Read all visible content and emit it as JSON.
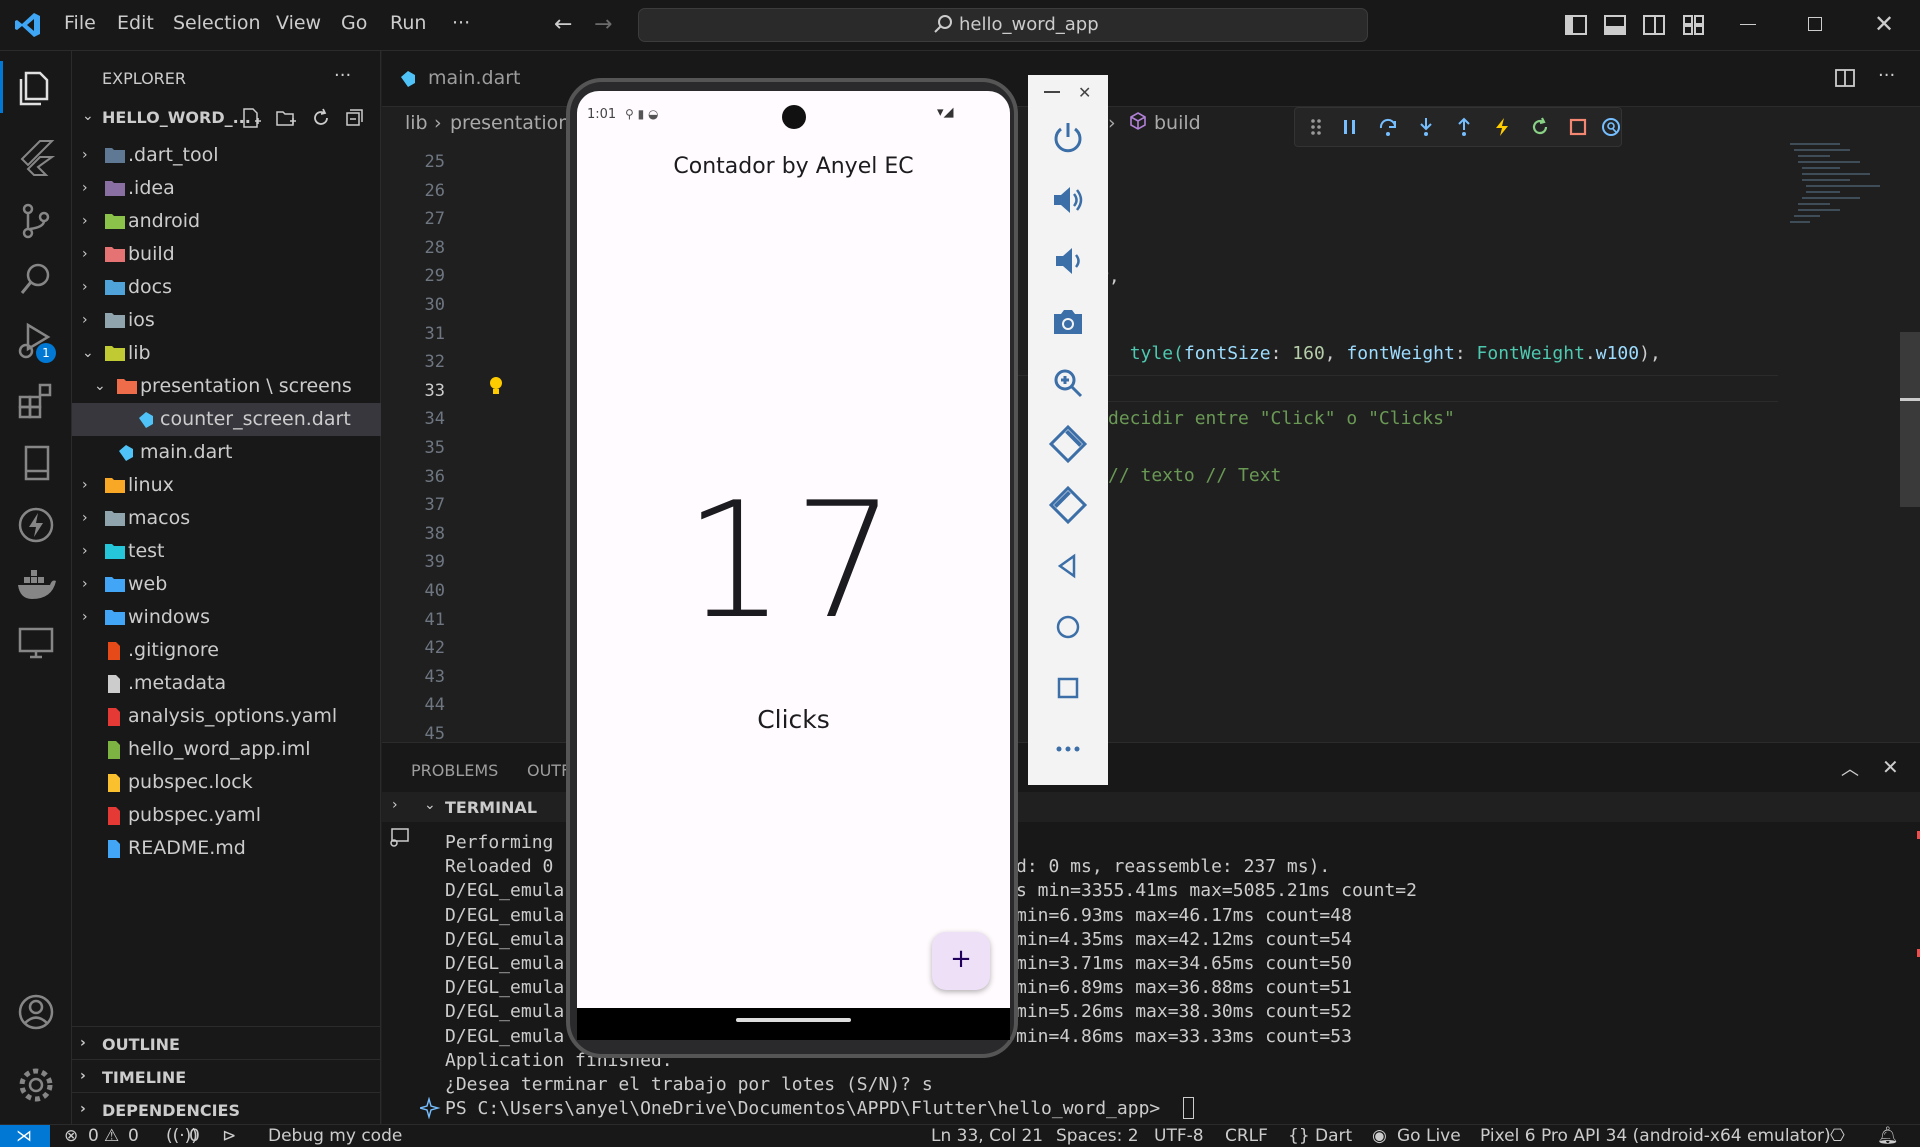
{
  "menu": [
    "File",
    "Edit",
    "Selection",
    "View",
    "Go",
    "Run",
    "···"
  ],
  "search": {
    "text": "hello_word_app"
  },
  "explorer": {
    "title": "EXPLORER",
    "more": "···",
    "project": "HELLO_WORD_...",
    "items": [
      {
        "label": ".dart_tool",
        "type": "folder",
        "color": "#5f7894"
      },
      {
        "label": ".idea",
        "type": "folder",
        "color": "#8a6fa3"
      },
      {
        "label": "android",
        "type": "folder",
        "color": "#8bc34a"
      },
      {
        "label": "build",
        "type": "folder",
        "color": "#e57373"
      },
      {
        "label": "docs",
        "type": "folder",
        "color": "#4fa3d9"
      },
      {
        "label": "ios",
        "type": "folder",
        "color": "#90a4ae"
      },
      {
        "label": "lib",
        "type": "folder-open",
        "color": "#c0ca33"
      },
      {
        "label": "presentation \\ screens",
        "type": "folder-open",
        "color": "#ef6c4a"
      },
      {
        "label": "counter_screen.dart",
        "type": "dart",
        "color": "#4fc3f7"
      },
      {
        "label": "main.dart",
        "type": "dart",
        "color": "#4fc3f7"
      },
      {
        "label": "linux",
        "type": "folder",
        "color": "#f9a825"
      },
      {
        "label": "macos",
        "type": "folder",
        "color": "#90a4ae"
      },
      {
        "label": "test",
        "type": "folder",
        "color": "#26c6da"
      },
      {
        "label": "web",
        "type": "folder",
        "color": "#42a5f5"
      },
      {
        "label": "windows",
        "type": "folder",
        "color": "#42a5f5"
      },
      {
        "label": ".gitignore",
        "type": "file",
        "color": "#e64a19"
      },
      {
        "label": ".metadata",
        "type": "file",
        "color": "#cccccc"
      },
      {
        "label": "analysis_options.yaml",
        "type": "file",
        "color": "#e53935"
      },
      {
        "label": "hello_word_app.iml",
        "type": "file",
        "color": "#7cb342"
      },
      {
        "label": "pubspec.lock",
        "type": "file",
        "color": "#fbc02d"
      },
      {
        "label": "pubspec.yaml",
        "type": "file",
        "color": "#e53935"
      },
      {
        "label": "README.md",
        "type": "file",
        "color": "#42a5f5"
      }
    ],
    "sections": [
      "OUTLINE",
      "TIMELINE",
      "DEPENDENCIES"
    ]
  },
  "editor": {
    "tab_main": "main.dart",
    "breadcrumb_lib": "lib",
    "breadcrumb_presentation": "presentation",
    "breadcrumb_build": "build",
    "line_numbers": [
      "25",
      "26",
      "27",
      "28",
      "29",
      "30",
      "31",
      "32",
      "33",
      "34",
      "35",
      "36",
      "37",
      "38",
      "39",
      "40",
      "41",
      "42",
      "43",
      "44",
      "45"
    ],
    "code": {
      "l29": "r,",
      "l31_a": "tyle(",
      "l31_b": "fontSize",
      "l31_c": ": ",
      "l31_d": "160",
      "l31_e": ", ",
      "l31_f": "fontWeight",
      "l31_g": ": ",
      "l31_h": "FontWeight",
      "l31_i": ".",
      "l31_j": "w100",
      "l31_k": "),",
      "l34": "decidir entre \"Click\" o \"Clicks\"",
      "l36": "// texto // Text"
    }
  },
  "panel": {
    "tab_problems": "PROBLEMS",
    "tab_output": "OUTF",
    "terminal_title": "TERMINAL",
    "left_lines": [
      "Performing",
      "Reloaded 0",
      "D/EGL_emula",
      "D/EGL_emula",
      "D/EGL_emula",
      "D/EGL_emula",
      "D/EGL_emula",
      "D/EGL_emula",
      "D/EGL_emula",
      "Application finished.",
      "¿Desea terminar el trabajo por lotes (S/N)? s",
      "PS C:\\Users\\anyel\\OneDrive\\Documentos\\APPD\\Flutter\\hello_word_app> "
    ],
    "right_lines": [
      "",
      "d: 0 ms, reassemble: 237 ms).",
      "s min=3355.41ms max=5085.21ms count=2",
      "min=6.93ms max=46.17ms count=48",
      "min=4.35ms max=42.12ms count=54",
      "min=3.71ms max=34.65ms count=50",
      "min=6.89ms max=36.88ms count=51",
      "min=5.26ms max=38.30ms count=52",
      "min=4.86ms max=33.33ms count=53"
    ]
  },
  "phone": {
    "time": "1:01",
    "app_title": "Contador by Anyel EC",
    "counter": "17",
    "clicks_label": "Clicks",
    "fab": "+"
  },
  "status": {
    "errors": "0",
    "warnings": "0",
    "ports": "0",
    "debug": "Debug my code",
    "position": "Ln 33, Col 21",
    "spaces": "Spaces: 2",
    "encoding": "UTF-8",
    "eol": "CRLF",
    "language": "{} Dart",
    "golive": "Go Live",
    "device": "Pixel 6 Pro API 34 (android-x64 emulator)"
  },
  "colors": {
    "accent": "#0078d4",
    "keyword": "#9cdcfe",
    "number": "#b5cea8",
    "type": "#4ec9b0",
    "comment": "#6a9955",
    "string": "#ce9178",
    "fab_bg": "#ede0f7"
  }
}
